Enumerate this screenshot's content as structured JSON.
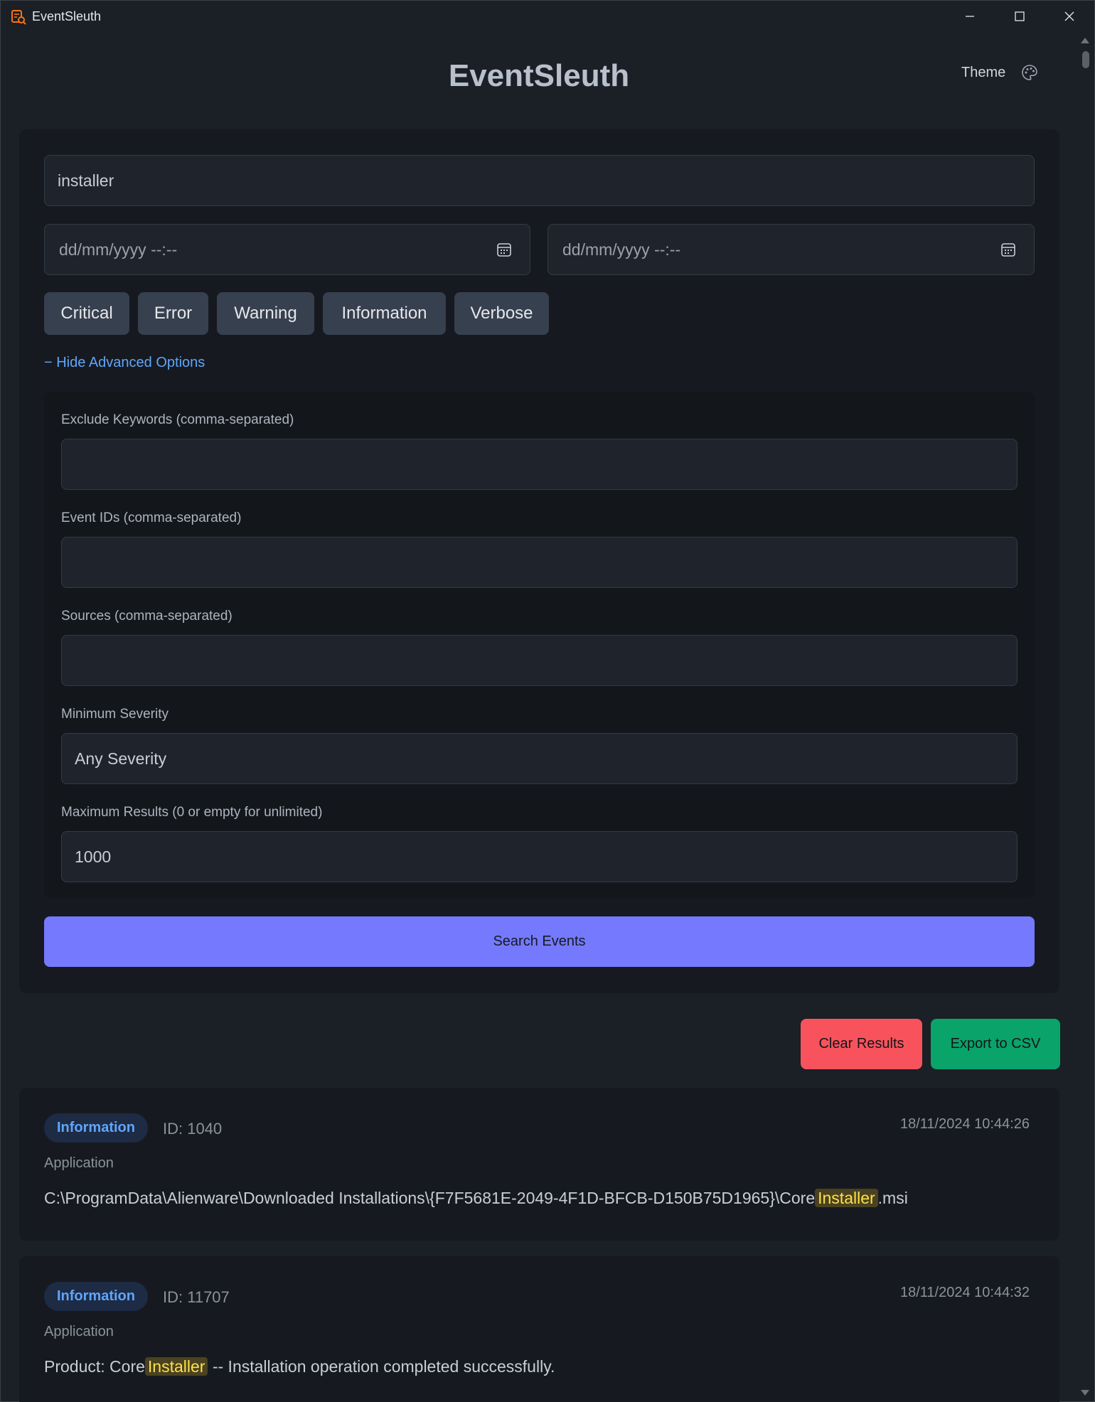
{
  "window": {
    "title": "EventSleuth"
  },
  "header": {
    "title": "EventSleuth",
    "theme_label": "Theme"
  },
  "search": {
    "keyword_value": "installer",
    "start_date_placeholder": "dd/mm/yyyy --:--",
    "end_date_placeholder": "dd/mm/yyyy --:--",
    "levels": [
      "Critical",
      "Error",
      "Warning",
      "Information",
      "Verbose"
    ],
    "advanced_toggle": "− Hide Advanced Options",
    "search_button": "Search Events"
  },
  "advanced": {
    "exclude_label": "Exclude Keywords (comma-separated)",
    "exclude_value": "",
    "event_ids_label": "Event IDs (comma-separated)",
    "event_ids_value": "",
    "sources_label": "Sources (comma-separated)",
    "sources_value": "",
    "min_severity_label": "Minimum Severity",
    "min_severity_value": "Any Severity",
    "max_results_label": "Maximum Results (0 or empty for unlimited)",
    "max_results_value": "1000"
  },
  "actions": {
    "clear": "Clear Results",
    "export": "Export to CSV"
  },
  "results": [
    {
      "level": "Information",
      "id": "ID: 1040",
      "time": "18/11/2024 10:44:26",
      "source": "Application",
      "msg_before": "C:\\ProgramData\\Alienware\\Downloaded Installations\\{F7F5681E-2049-4F1D-BFCB-D150B75D1965}\\Core",
      "msg_highlight": "Installer",
      "msg_after": ".msi"
    },
    {
      "level": "Information",
      "id": "ID: 11707",
      "time": "18/11/2024 10:44:32",
      "source": "Application",
      "msg_before": "Product: Core",
      "msg_highlight": "Installer",
      "msg_after": " -- Installation operation completed successfully."
    }
  ],
  "colors": {
    "accent": "#7479fd",
    "danger": "#f8535c",
    "success": "#0aa36a",
    "info": "#60a5fa",
    "highlight": "#fde047"
  }
}
